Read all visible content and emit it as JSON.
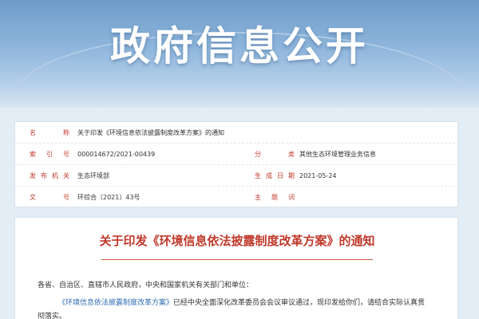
{
  "banner": {
    "title": "政府信息公开"
  },
  "meta": {
    "rows": [
      {
        "label": "名　称",
        "value": "关于印发《环境信息依法披露制度改革方案》的通知"
      },
      {
        "label": "索引号",
        "value": "000014672/2021-00439",
        "label2": "分　类",
        "value2": "其他生态环境管理业务信息"
      },
      {
        "label": "发布机关",
        "value": "生态环境部",
        "label2": "生成日期",
        "value2": "2021-05-24"
      },
      {
        "label": "文　号",
        "value": "环综合〔2021〕43号",
        "label2": "主题词",
        "value2": ""
      }
    ]
  },
  "content": {
    "title": "关于印发《环境信息依法披露制度改革方案》的通知",
    "salutation": "各省、自治区、直辖市人民政府，中央和国家机关有关部门和单位：",
    "body_link": "《环境信息依法披露制度改革方案》",
    "body_text": "已经中央全面深化改革委员会会议审议通过，现印发给你们，请结合实际认真贯",
    "body_continued": "彻落实。"
  },
  "colors": {
    "label_red": "#c0392b",
    "link_blue": "#2e6db4",
    "banner_blue": "#6d9cc9"
  }
}
